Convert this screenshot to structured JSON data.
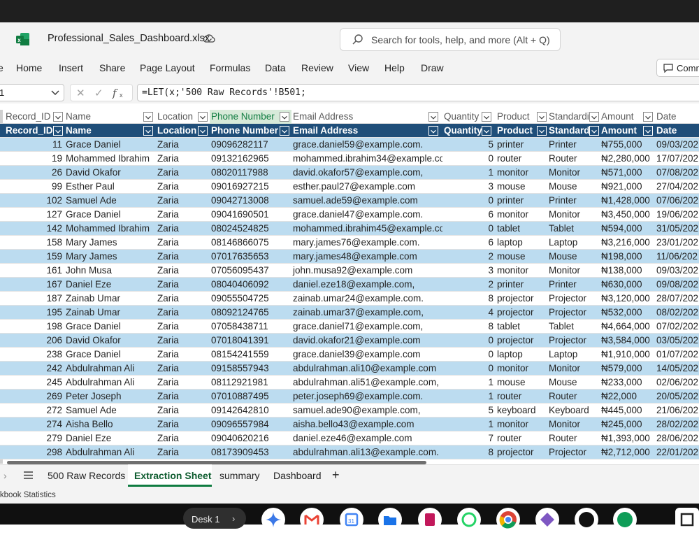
{
  "window": {
    "filename": "Professional_Sales_Dashboard.xlsx",
    "search_placeholder": "Search for tools, help, and more (Alt + Q)"
  },
  "menu": [
    "Home",
    "Insert",
    "Share",
    "Page Layout",
    "Formulas",
    "Data",
    "Review",
    "View",
    "Help",
    "Draw"
  ],
  "comments_label": "Comm",
  "namebox": "1",
  "formula": "=LET(x;'500 Raw Records'!B501;",
  "columns": [
    "Record_ID",
    "Name",
    "Location",
    "Phone Number",
    "Email Address",
    "Quantity",
    "Product",
    "Standardi",
    "Amount",
    "Date"
  ],
  "rows": [
    [
      "11",
      "Grace Daniel",
      "Zaria",
      "09096282117",
      "grace.daniel59@example.com.",
      "5",
      "printer",
      "Printer",
      "₦755,000",
      "09/03/202"
    ],
    [
      "19",
      "Mohammed Ibrahim",
      "Zaria",
      "09132162965",
      "mohammed.ibrahim34@example.co",
      "0",
      "router",
      "Router",
      "₦2,280,000",
      "17/07/202"
    ],
    [
      "26",
      "David Okafor",
      "Zaria",
      "08020117988",
      "david.okafor57@example.com,",
      "1",
      "monitor",
      "Monitor",
      "₦571,000",
      "07/08/202"
    ],
    [
      "99",
      "Esther Paul",
      "Zaria",
      "09016927215",
      "esther.paul27@example.com",
      "3",
      "mouse",
      "Mouse",
      "₦921,000",
      "27/04/202"
    ],
    [
      "102",
      "Samuel Ade",
      "Zaria",
      "09042713008",
      "samuel.ade59@example.com",
      "0",
      "printer",
      "Printer",
      "₦1,428,000",
      "07/06/202"
    ],
    [
      "127",
      "Grace Daniel",
      "Zaria",
      "09041690501",
      "grace.daniel47@example.com.",
      "6",
      "monitor",
      "Monitor",
      "₦3,450,000",
      "19/06/202"
    ],
    [
      "142",
      "Mohammed Ibrahim",
      "Zaria",
      "08024524825",
      "mohammed.ibrahim45@example.co",
      "0",
      "tablet",
      "Tablet",
      "₦594,000",
      "31/05/202"
    ],
    [
      "158",
      "Mary James",
      "Zaria",
      "08146866075",
      "mary.james76@example.com.",
      "6",
      "laptop",
      "Laptop",
      "₦3,216,000",
      "23/01/202"
    ],
    [
      "159",
      "Mary James",
      "Zaria",
      "07017635653",
      "mary.james48@example.com",
      "2",
      "mouse",
      "Mouse",
      "₦198,000",
      "11/06/202"
    ],
    [
      "161",
      "John Musa",
      "Zaria",
      "07056095437",
      "john.musa92@example.com",
      "3",
      "monitor",
      "Monitor",
      "₦138,000",
      "09/03/202"
    ],
    [
      "167",
      "Daniel Eze",
      "Zaria",
      "08040406092",
      "daniel.eze18@example.com,",
      "2",
      "printer",
      "Printer",
      "₦630,000",
      "09/08/202"
    ],
    [
      "187",
      "Zainab Umar",
      "Zaria",
      "09055504725",
      "zainab.umar24@example.com.",
      "8",
      "projector",
      "Projector",
      "₦3,120,000",
      "28/07/202"
    ],
    [
      "195",
      "Zainab Umar",
      "Zaria",
      "08092124765",
      "zainab.umar37@example.com,",
      "4",
      "projector",
      "Projector",
      "₦532,000",
      "08/02/202"
    ],
    [
      "198",
      "Grace Daniel",
      "Zaria",
      "07058438711",
      "grace.daniel71@example.com,",
      "8",
      "tablet",
      "Tablet",
      "₦4,664,000",
      "07/02/202"
    ],
    [
      "206",
      "David Okafor",
      "Zaria",
      "07018041391",
      "david.okafor21@example.com",
      "0",
      "projector",
      "Projector",
      "₦3,584,000",
      "03/05/202"
    ],
    [
      "238",
      "Grace Daniel",
      "Zaria",
      "08154241559",
      "grace.daniel39@example.com",
      "0",
      "laptop",
      "Laptop",
      "₦1,910,000",
      "01/07/202"
    ],
    [
      "242",
      "Abdulrahman Ali",
      "Zaria",
      "09158557943",
      "abdulrahman.ali10@example.com",
      "0",
      "monitor",
      "Monitor",
      "₦579,000",
      "14/05/202"
    ],
    [
      "245",
      "Abdulrahman Ali",
      "Zaria",
      "08112921981",
      "abdulrahman.ali51@example.com,",
      "1",
      "mouse",
      "Mouse",
      "₦233,000",
      "02/06/202"
    ],
    [
      "269",
      "Peter Joseph",
      "Zaria",
      "07010887495",
      "peter.joseph69@example.com.",
      "1",
      "router",
      "Router",
      "₦22,000",
      "20/05/202"
    ],
    [
      "272",
      "Samuel Ade",
      "Zaria",
      "09142642810",
      "samuel.ade90@example.com,",
      "5",
      "keyboard",
      "Keyboard",
      "₦445,000",
      "21/06/202"
    ],
    [
      "274",
      "Aisha Bello",
      "Zaria",
      "09096557984",
      "aisha.bello43@example.com",
      "1",
      "monitor",
      "Monitor",
      "₦245,000",
      "28/02/202"
    ],
    [
      "279",
      "Daniel Eze",
      "Zaria",
      "09040620216",
      "daniel.eze46@example.com",
      "7",
      "router",
      "Router",
      "₦1,393,000",
      "28/06/202"
    ],
    [
      "298",
      "Abdulrahman Ali",
      "Zaria",
      "08173909453",
      "abdulrahman.ali13@example.com.",
      "8",
      "projector",
      "Projector",
      "₦2,712,000",
      "22/01/202"
    ]
  ],
  "sheet_tabs": [
    "500 Raw Records",
    "Extraction Sheet",
    "summary",
    "Dashboard"
  ],
  "active_tab": "Extraction Sheet",
  "status_text": "rkbook Statistics",
  "taskbar": {
    "desk_label": "Desk 1"
  },
  "colors": {
    "excel_green": "#107c41",
    "header_blue": "#1f4e79",
    "band_blue": "#bcdcf0",
    "selected_col": "#d7ead9"
  }
}
